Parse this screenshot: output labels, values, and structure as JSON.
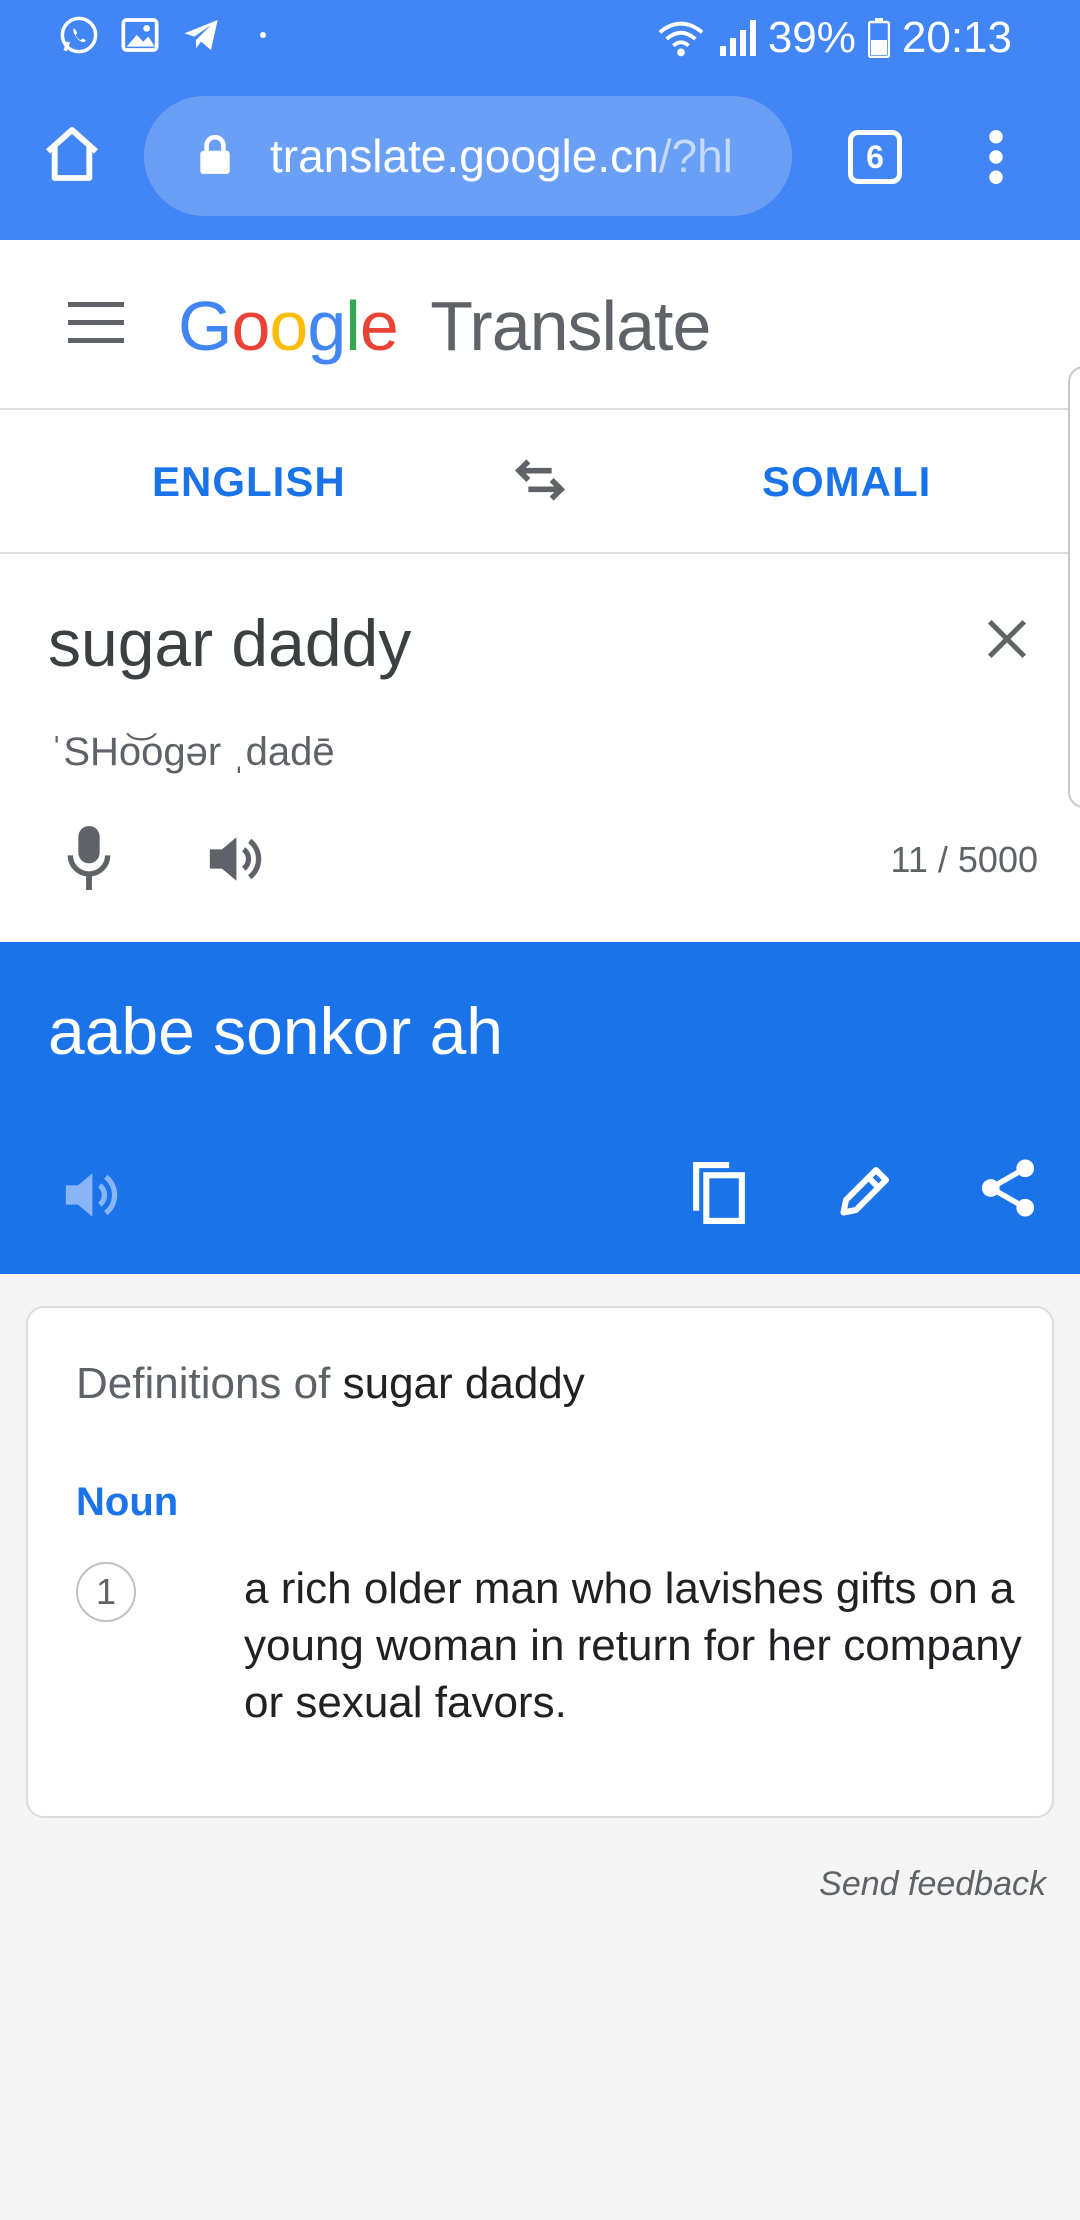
{
  "status_bar": {
    "battery": "39%",
    "time": "20:13"
  },
  "browser": {
    "url_main": "translate.google.cn",
    "url_rest": "/?hl",
    "tab_count": "6"
  },
  "header": {
    "logo_letters": [
      "G",
      "o",
      "o",
      "g",
      "l",
      "e"
    ],
    "product": "Translate"
  },
  "languages": {
    "source": "ENGLISH",
    "target": "SOMALI"
  },
  "source": {
    "text": "sugar daddy",
    "phonetic": "ˈSHo͝ogər ˌdadē",
    "char_count": "11 / 5000"
  },
  "target": {
    "text": "aabe sonkor ah"
  },
  "definitions": {
    "title_prefix": "Definitions of",
    "term": "sugar daddy",
    "part_of_speech": "Noun",
    "items": [
      {
        "number": "1",
        "text": "a rich older man who lavishes gifts on a young woman in return for her company or sexual favors."
      }
    ]
  },
  "feedback": "Send feedback",
  "colors": {
    "chrome": "#4285f4",
    "accent": "#1a73e8",
    "logo": [
      "#4285f4",
      "#ea4335",
      "#fbbc05",
      "#4285f4",
      "#34a853",
      "#ea4335"
    ]
  }
}
